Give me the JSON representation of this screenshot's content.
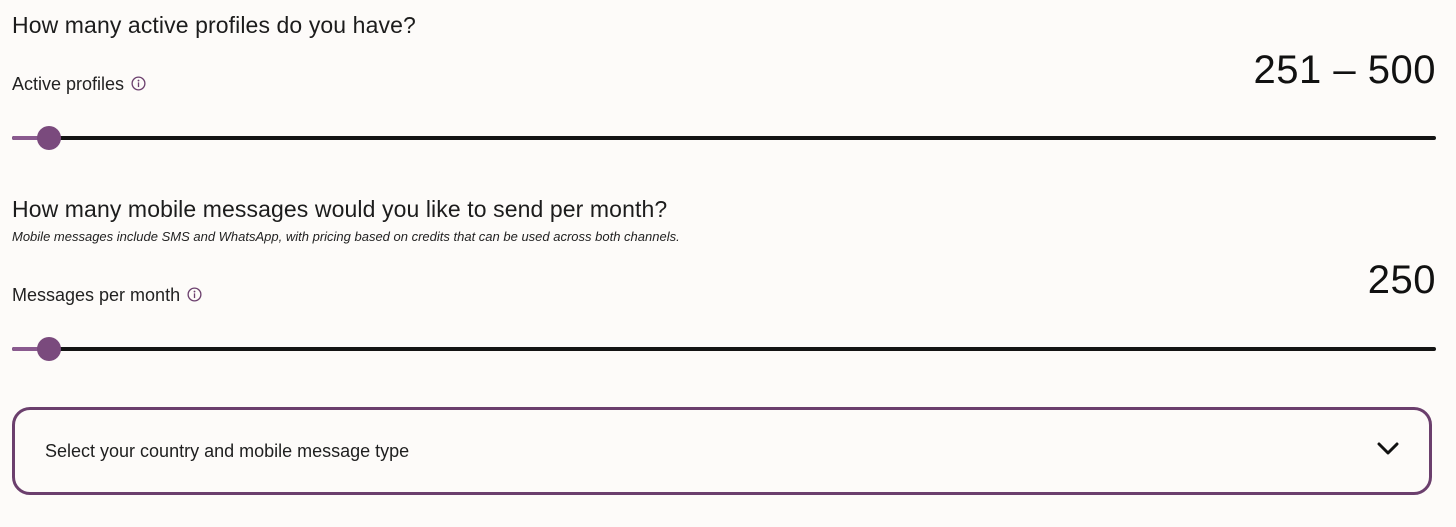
{
  "profiles": {
    "question": "How many active profiles do you have?",
    "label": "Active profiles",
    "value": "251 – 500",
    "slider_fraction": 0.026
  },
  "messages": {
    "question": "How many mobile messages would you like to send per month?",
    "note": "Mobile messages include SMS and WhatsApp, with pricing based on credits that can be used across both channels.",
    "label": "Messages per month",
    "value": "250",
    "slider_fraction": 0.026
  },
  "country_select": {
    "placeholder": "Select your country and mobile message type"
  },
  "colors": {
    "accent": "#7a4a7d",
    "border": "#6b3f6d",
    "track": "#141414",
    "background": "#fdfbf9"
  },
  "icons": {
    "info": "info-icon",
    "dropdown": "chevron-down-icon"
  }
}
